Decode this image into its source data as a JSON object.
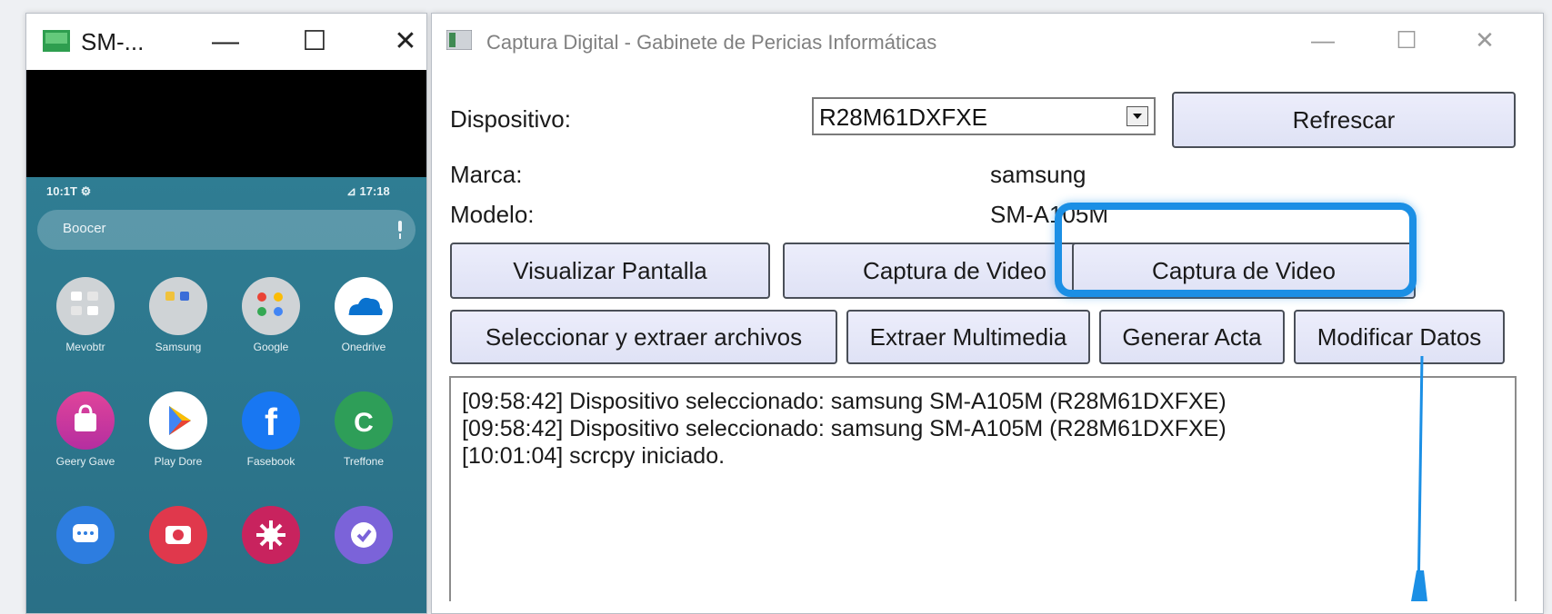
{
  "phone_window": {
    "title": "SM-...",
    "controls": {
      "minimize": "—",
      "maximize": "☐",
      "close": "✕"
    },
    "status_left": "10:1T ⚙",
    "status_right": "⊿ 17:18",
    "search_placeholder": "Boocer",
    "apps": [
      {
        "label": "Mevobtr",
        "icon": "folder-icon",
        "color": "#cfd3d6"
      },
      {
        "label": "Samsung",
        "icon": "folder-icon",
        "color": "#cfd3d6"
      },
      {
        "label": "Google",
        "icon": "folder-icon",
        "color": "#cfd3d6"
      },
      {
        "label": "Onedrive",
        "icon": "onedrive-icon",
        "color": "#ffffff"
      },
      {
        "label": "Geery Gave",
        "icon": "store-icon",
        "color": "#d6338f"
      },
      {
        "label": "Play Dore",
        "icon": "play-store-icon",
        "color": "#ffffff"
      },
      {
        "label": "Fasebook",
        "icon": "facebook-icon",
        "color": "#1877f2"
      },
      {
        "label": "Treffone",
        "icon": "phone-icon",
        "color": "#2e9e58"
      },
      {
        "label": "",
        "icon": "messages-icon",
        "color": "#2d7de0"
      },
      {
        "label": "",
        "icon": "camera-icon",
        "color": "#e0384c"
      },
      {
        "label": "",
        "icon": "bixby-icon",
        "color": "#c8235e"
      },
      {
        "label": "",
        "icon": "clock-icon",
        "color": "#7b63d9"
      }
    ]
  },
  "main_window": {
    "title": "Captura Digital - Gabinete de Pericias Informáticas",
    "controls": {
      "minimize": "—",
      "maximize": "☐",
      "close": "✕"
    },
    "device_label": "Dispositivo:",
    "device_value": "R28M61DXFXE",
    "refresh_button": "Refrescar",
    "brand_label": "Marca:",
    "brand_value": "samsung",
    "model_label": "Modelo:",
    "model_value": "SM-A105M",
    "buttons_row1": [
      "Visualizar Pantalla",
      "Captura de Video",
      "Captura de Video"
    ],
    "buttons_row2": [
      "Seleccionar y extraer archivos",
      "Extraer Multimedia",
      "Generar Acta",
      "Modificar Datos"
    ],
    "log_lines": [
      "[09:58:42] Dispositivo seleccionado: samsung SM-A105M (R28M61DXFXE)",
      "[09:58:42] Dispositivo seleccionado: samsung SM-A105M (R28M61DXFXE)",
      "[10:01:04] scrcpy iniciado."
    ],
    "accent_color": "#1b8fe5"
  }
}
